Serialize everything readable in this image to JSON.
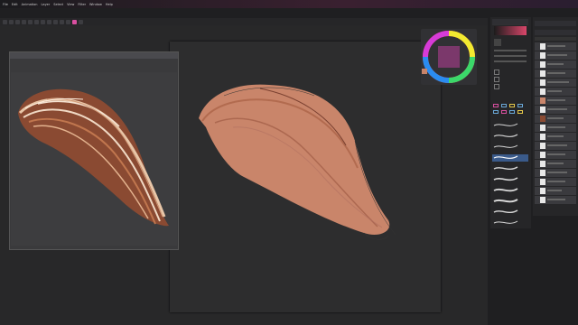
{
  "menubar": {
    "items": [
      "File",
      "Edit",
      "Animation",
      "Layer",
      "Select",
      "View",
      "Filter",
      "Window",
      "Help"
    ]
  },
  "toolbar": {
    "tools": [
      "new",
      "open",
      "save",
      "undo",
      "redo",
      "brush",
      "eraser",
      "select",
      "move",
      "transform",
      "fill",
      "text"
    ]
  },
  "colors": {
    "accent": "#d94fa0",
    "canvas_bg": "#2d2d2e",
    "hair_main": "#c8846a"
  },
  "right_panel": {
    "layer_count": 18
  },
  "brush_presets": {
    "count": 10
  }
}
